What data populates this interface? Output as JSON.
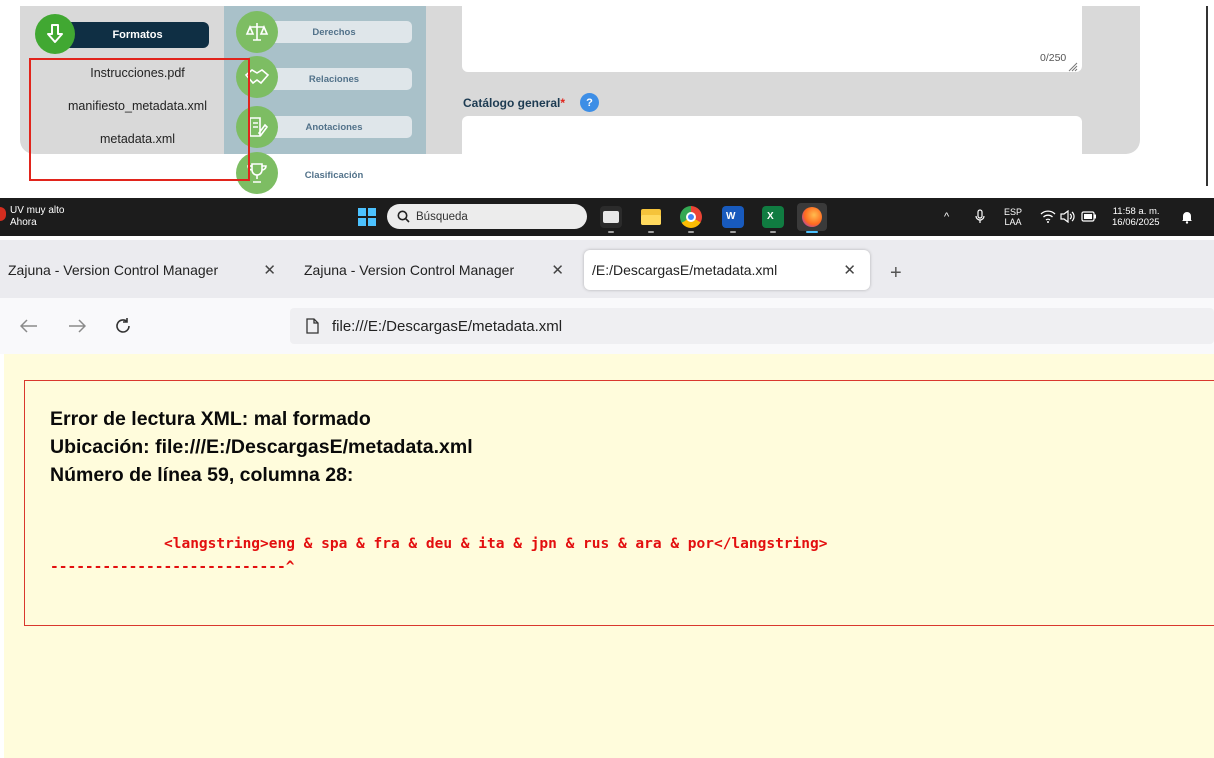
{
  "app_panel": {
    "formatos_label": "Formatos",
    "files": [
      "Instrucciones.pdf",
      "manifiesto_metadata.xml",
      "metadata.xml"
    ],
    "sections": [
      "Derechos",
      "Relaciones",
      "Anotaciones",
      "Clasificación"
    ],
    "char_counter": "0/250",
    "catalog_label": "Catálogo general",
    "required_mark": "*",
    "help_glyph": "?"
  },
  "taskbar": {
    "weather_title": "UV muy alto",
    "weather_sub": "Ahora",
    "search_placeholder": "Búsqueda",
    "lang_line1": "ESP",
    "lang_line2": "LAA",
    "time": "11:58 a. m.",
    "date": "16/06/2025",
    "apps": [
      "file-explorer-icon",
      "folder-icon",
      "chrome-icon",
      "word-icon",
      "excel-icon",
      "firefox-icon"
    ]
  },
  "browser": {
    "tabs": [
      {
        "label": "Zajuna - Version Control Manager"
      },
      {
        "label": "Zajuna - Version Control Manager"
      },
      {
        "label": "/E:/DescargasE/metadata.xml"
      }
    ],
    "close_glyph": "✕",
    "new_tab_glyph": "+",
    "url": "file:///E:/DescargasE/metadata.xml"
  },
  "error": {
    "title": "Error de lectura XML: mal formado",
    "location": "Ubicación: file:///E:/DescargasE/metadata.xml",
    "line_info": "Número de línea 59, columna 28:",
    "source_line": "<langstring>eng & spa & fra & deu & ita & jpn & rus & ara & por</langstring>",
    "pointer_line": "---------------------------^"
  },
  "colors": {
    "error_text": "#e30f0f",
    "error_border": "#d9382e",
    "error_bg": "#fffcdc",
    "accent_green": "#41a832",
    "brand_navy": "#0f2f44",
    "highlight_box": "#e1241c"
  }
}
